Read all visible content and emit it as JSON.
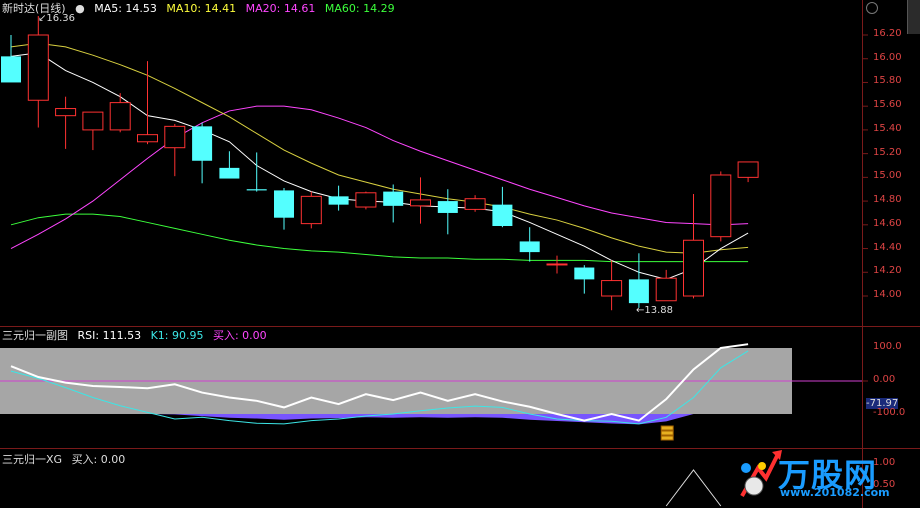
{
  "app": {
    "stock_name": "新时达(日线)"
  },
  "main_legend": {
    "ma5": "MA5: 14.53",
    "ma10": "MA10: 14.41",
    "ma20": "MA20: 14.61",
    "ma60": "MA60: 14.29",
    "colors": {
      "ma5": "#ffffff",
      "ma10": "#ffff3c",
      "ma20": "#ff46ff",
      "ma60": "#3cff3c"
    }
  },
  "price_axis": [
    "16.20",
    "16.00",
    "15.80",
    "15.60",
    "15.40",
    "15.20",
    "15.00",
    "14.80",
    "14.60",
    "14.40",
    "14.20",
    "14.00"
  ],
  "markers": {
    "high": "16.36",
    "low": "13.88"
  },
  "sub1_legend": {
    "name": "三元归一副图",
    "rsi": "RSI: 111.53",
    "k1": "K1: 90.95",
    "buy": "买入: 0.00"
  },
  "sub1_axis": [
    "100.0",
    "0.00",
    "-71.97",
    "-100.0"
  ],
  "sub2_legend": {
    "name": "三元归一XG",
    "buy": "买入: 0.00"
  },
  "sub2_axis": [
    "1.00",
    "0.50"
  ],
  "logo": {
    "text": "万股网",
    "url": "www.201082.com"
  },
  "chart_data": {
    "type": "candlestick",
    "title": "新时达(日线)",
    "candles": [
      {
        "o": 16.02,
        "h": 16.2,
        "l": 15.95,
        "c": 15.8
      },
      {
        "o": 15.65,
        "h": 16.36,
        "l": 15.42,
        "c": 16.2
      },
      {
        "o": 15.52,
        "h": 15.68,
        "l": 15.24,
        "c": 15.58
      },
      {
        "o": 15.4,
        "h": 15.55,
        "l": 15.23,
        "c": 15.55
      },
      {
        "o": 15.4,
        "h": 15.71,
        "l": 15.38,
        "c": 15.63
      },
      {
        "o": 15.3,
        "h": 15.98,
        "l": 15.28,
        "c": 15.36
      },
      {
        "o": 15.25,
        "h": 15.45,
        "l": 15.01,
        "c": 15.43
      },
      {
        "o": 15.43,
        "h": 15.46,
        "l": 14.95,
        "c": 15.14
      },
      {
        "o": 15.08,
        "h": 15.22,
        "l": 15.07,
        "c": 14.99
      },
      {
        "o": 14.9,
        "h": 15.21,
        "l": 14.88,
        "c": 14.89
      },
      {
        "o": 14.89,
        "h": 14.91,
        "l": 14.56,
        "c": 14.66
      },
      {
        "o": 14.61,
        "h": 14.88,
        "l": 14.57,
        "c": 14.84
      },
      {
        "o": 14.84,
        "h": 14.93,
        "l": 14.72,
        "c": 14.77
      },
      {
        "o": 14.75,
        "h": 14.88,
        "l": 14.73,
        "c": 14.87
      },
      {
        "o": 14.88,
        "h": 14.94,
        "l": 14.62,
        "c": 14.76
      },
      {
        "o": 14.76,
        "h": 15.0,
        "l": 14.61,
        "c": 14.81
      },
      {
        "o": 14.8,
        "h": 14.9,
        "l": 14.52,
        "c": 14.7
      },
      {
        "o": 14.73,
        "h": 14.85,
        "l": 14.71,
        "c": 14.82
      },
      {
        "o": 14.77,
        "h": 14.92,
        "l": 14.58,
        "c": 14.59
      },
      {
        "o": 14.46,
        "h": 14.58,
        "l": 14.29,
        "c": 14.37
      },
      {
        "o": 14.27,
        "h": 14.34,
        "l": 14.19,
        "c": 14.27
      },
      {
        "o": 14.24,
        "h": 14.26,
        "l": 14.02,
        "c": 14.14
      },
      {
        "o": 14.0,
        "h": 14.3,
        "l": 13.88,
        "c": 14.13
      },
      {
        "o": 14.14,
        "h": 14.36,
        "l": 13.9,
        "c": 13.94
      },
      {
        "o": 13.96,
        "h": 14.22,
        "l": 13.96,
        "c": 14.15
      },
      {
        "o": 14.0,
        "h": 14.86,
        "l": 13.98,
        "c": 14.47
      },
      {
        "o": 14.5,
        "h": 15.05,
        "l": 14.46,
        "c": 15.02
      },
      {
        "o": 15.0,
        "h": 15.1,
        "l": 14.96,
        "c": 15.13
      }
    ],
    "ma5": [
      16.02,
      16.05,
      15.9,
      15.8,
      15.68,
      15.52,
      15.48,
      15.4,
      15.3,
      15.1,
      14.97,
      14.88,
      14.82,
      14.8,
      14.79,
      14.76,
      14.75,
      14.74,
      14.71,
      14.62,
      14.52,
      14.42,
      14.3,
      14.2,
      14.14,
      14.23,
      14.4,
      14.53
    ],
    "ma10": [
      16.1,
      16.13,
      16.1,
      16.03,
      15.95,
      15.86,
      15.75,
      15.63,
      15.51,
      15.37,
      15.23,
      15.12,
      15.02,
      14.96,
      14.9,
      14.86,
      14.82,
      14.79,
      14.75,
      14.69,
      14.64,
      14.57,
      14.49,
      14.42,
      14.37,
      14.36,
      14.39,
      14.41
    ],
    "ma20": [
      14.4,
      14.52,
      14.65,
      14.8,
      14.98,
      15.16,
      15.33,
      15.46,
      15.56,
      15.6,
      15.6,
      15.57,
      15.5,
      15.42,
      15.31,
      15.22,
      15.14,
      15.06,
      14.98,
      14.9,
      14.83,
      14.76,
      14.7,
      14.66,
      14.62,
      14.61,
      14.6,
      14.61
    ],
    "ma60": [
      14.6,
      14.66,
      14.69,
      14.69,
      14.67,
      14.62,
      14.57,
      14.52,
      14.47,
      14.43,
      14.4,
      14.38,
      14.37,
      14.35,
      14.33,
      14.32,
      14.32,
      14.31,
      14.31,
      14.3,
      14.3,
      14.3,
      14.29,
      14.29,
      14.29,
      14.29,
      14.29,
      14.29
    ],
    "rsi": [
      45,
      12,
      -5,
      -15,
      -18,
      -22,
      -10,
      -35,
      -50,
      -60,
      -80,
      -50,
      -70,
      -40,
      -58,
      -35,
      -60,
      -40,
      -62,
      -78,
      -100,
      -120,
      -100,
      -120,
      -55,
      35,
      100,
      111.53
    ],
    "k1": [
      30,
      8,
      -20,
      -50,
      -75,
      -95,
      -115,
      -110,
      -120,
      -128,
      -130,
      -120,
      -115,
      -106,
      -100,
      -90,
      -82,
      -76,
      -80,
      -100,
      -115,
      -120,
      -122,
      -130,
      -110,
      -50,
      40,
      90.95
    ],
    "purple_fill": [
      0,
      0,
      0,
      0,
      0,
      0,
      -5,
      -25,
      -45,
      -55,
      -70,
      -55,
      -50,
      -40,
      -45,
      -40,
      -45,
      -40,
      -45,
      -70,
      -85,
      -100,
      -115,
      -125,
      -90,
      0,
      0,
      0
    ]
  }
}
